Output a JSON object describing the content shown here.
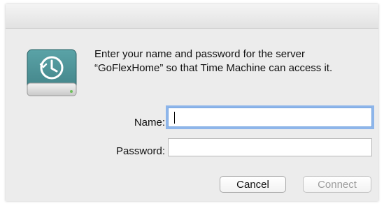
{
  "dialog": {
    "message": "Enter your name and password for the server “GoFlexHome” so that Time Machine can access it.",
    "icon": "time-machine-drive-icon"
  },
  "form": {
    "name_label": "Name:",
    "name_value": "",
    "password_label": "Password:",
    "password_value": ""
  },
  "buttons": {
    "cancel": "Cancel",
    "connect": "Connect"
  }
}
